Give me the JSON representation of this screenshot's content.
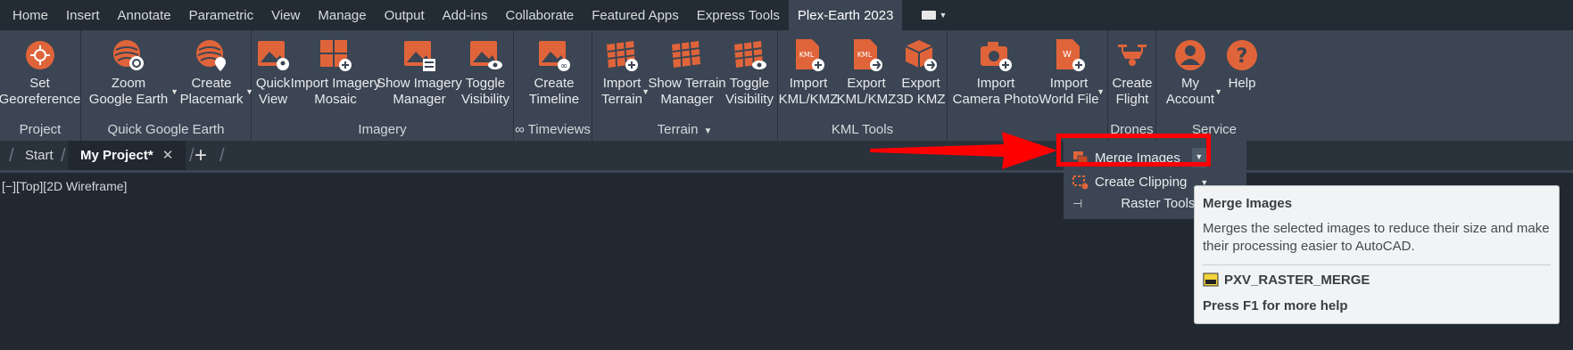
{
  "menu": {
    "tabs": [
      "Home",
      "Insert",
      "Annotate",
      "Parametric",
      "View",
      "Manage",
      "Output",
      "Add-ins",
      "Collaborate",
      "Featured Apps",
      "Express Tools",
      "Plex-Earth 2023"
    ],
    "active_index": 11
  },
  "ribbon": {
    "panels": {
      "project": {
        "title": "Project",
        "set_georeference": [
          "Set",
          "Georeference"
        ]
      },
      "quick_google_earth": {
        "title": "Quick Google Earth",
        "zoom": [
          "Zoom",
          "Google Earth"
        ],
        "create_placemark": [
          "Create",
          "Placemark"
        ]
      },
      "imagery": {
        "title": "Imagery",
        "quick_view": [
          "Quick",
          "View"
        ],
        "import_mosaic": [
          "Import Imagery",
          "Mosaic"
        ],
        "show_manager": [
          "Show Imagery",
          "Manager"
        ],
        "toggle_visibility": [
          "Toggle",
          "Visibility"
        ]
      },
      "timeviews": {
        "title": "∞ Timeviews",
        "create_timeline": [
          "Create",
          "Timeline"
        ]
      },
      "terrain": {
        "title": "Terrain",
        "import_terrain": [
          "Import",
          "Terrain"
        ],
        "show_terrain_manager": [
          "Show Terrain",
          "Manager"
        ],
        "toggle_visibility": [
          "Toggle",
          "Visibility"
        ]
      },
      "kml_tools": {
        "title": "KML Tools",
        "import_kml": [
          "Import",
          "KML/KMZ"
        ],
        "export_kml": [
          "Export",
          "KML/KMZ"
        ],
        "export_3d": [
          "Export",
          "3D KMZ"
        ]
      },
      "camera": {
        "import_camera_photo": [
          "Import",
          "Camera Photo"
        ],
        "import_world_file": [
          "Import",
          "World File"
        ]
      },
      "drones": {
        "title": "Drones",
        "create_flight": [
          "Create",
          "Flight"
        ]
      },
      "service": {
        "title": "Service",
        "my_account": [
          "My",
          "Account"
        ],
        "help": "Help"
      }
    },
    "accent_color": "#e0643a"
  },
  "docbar": {
    "start": "Start",
    "project": "My Project*",
    "close": "✕",
    "add": "+"
  },
  "viewport": {
    "label": "[−][Top][2D Wireframe]"
  },
  "dropdown": {
    "merge_images": "Merge Images",
    "create_clipping": "Create Clipping",
    "raster_tools": "Raster Tools"
  },
  "tooltip": {
    "title": "Merge Images",
    "description": "Merges the selected images to reduce their size and make their processing easier to AutoCAD.",
    "command": "PXV_RASTER_MERGE",
    "help": "Press F1 for more help"
  }
}
